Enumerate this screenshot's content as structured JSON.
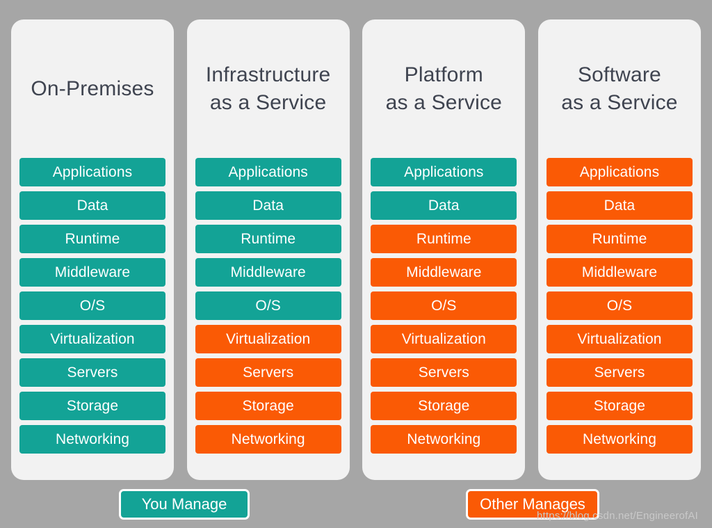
{
  "background_color": "#a6a6a6",
  "card_color": "#f2f2f2",
  "colors": {
    "managed_by_you": "#13a396",
    "managed_by_other": "#fa5a05",
    "title_text": "#3f4450",
    "bar_text": "#ffffff"
  },
  "columns": [
    {
      "title": "On-Premises",
      "layers": [
        {
          "label": "Applications",
          "owner": "teal"
        },
        {
          "label": "Data",
          "owner": "teal"
        },
        {
          "label": "Runtime",
          "owner": "teal"
        },
        {
          "label": "Middleware",
          "owner": "teal"
        },
        {
          "label": "O/S",
          "owner": "teal"
        },
        {
          "label": "Virtualization",
          "owner": "teal"
        },
        {
          "label": "Servers",
          "owner": "teal"
        },
        {
          "label": "Storage",
          "owner": "teal"
        },
        {
          "label": "Networking",
          "owner": "teal"
        }
      ]
    },
    {
      "title": "Infrastructure\nas a Service",
      "layers": [
        {
          "label": "Applications",
          "owner": "teal"
        },
        {
          "label": "Data",
          "owner": "teal"
        },
        {
          "label": "Runtime",
          "owner": "teal"
        },
        {
          "label": "Middleware",
          "owner": "teal"
        },
        {
          "label": "O/S",
          "owner": "teal"
        },
        {
          "label": "Virtualization",
          "owner": "orange"
        },
        {
          "label": "Servers",
          "owner": "orange"
        },
        {
          "label": "Storage",
          "owner": "orange"
        },
        {
          "label": "Networking",
          "owner": "orange"
        }
      ]
    },
    {
      "title": "Platform\nas a Service",
      "layers": [
        {
          "label": "Applications",
          "owner": "teal"
        },
        {
          "label": "Data",
          "owner": "teal"
        },
        {
          "label": "Runtime",
          "owner": "orange"
        },
        {
          "label": "Middleware",
          "owner": "orange"
        },
        {
          "label": "O/S",
          "owner": "orange"
        },
        {
          "label": "Virtualization",
          "owner": "orange"
        },
        {
          "label": "Servers",
          "owner": "orange"
        },
        {
          "label": "Storage",
          "owner": "orange"
        },
        {
          "label": "Networking",
          "owner": "orange"
        }
      ]
    },
    {
      "title": "Software\nas a Service",
      "layers": [
        {
          "label": "Applications",
          "owner": "orange"
        },
        {
          "label": "Data",
          "owner": "orange"
        },
        {
          "label": "Runtime",
          "owner": "orange"
        },
        {
          "label": "Middleware",
          "owner": "orange"
        },
        {
          "label": "O/S",
          "owner": "orange"
        },
        {
          "label": "Virtualization",
          "owner": "orange"
        },
        {
          "label": "Servers",
          "owner": "orange"
        },
        {
          "label": "Storage",
          "owner": "orange"
        },
        {
          "label": "Networking",
          "owner": "orange"
        }
      ]
    }
  ],
  "legend": {
    "you_manage": "You Manage",
    "other_manages": "Other Manages"
  },
  "watermark": "https://blog.csdn.net/EngineerofAI"
}
